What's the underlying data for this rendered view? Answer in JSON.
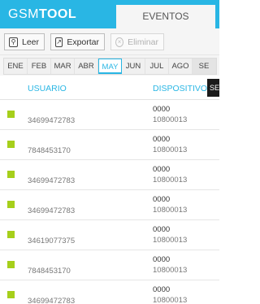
{
  "app": {
    "logo_part1": "GSM",
    "logo_part2": "TOOL",
    "tab_label": "EVENTOS"
  },
  "toolbar": {
    "read_label": "Leer",
    "export_label": "Exportar",
    "delete_label": "Eliminar"
  },
  "months": {
    "items": [
      "ENE",
      "FEB",
      "MAR",
      "ABR",
      "MAY",
      "JUN",
      "JUL",
      "AGO",
      "SE"
    ],
    "selected": "MAY"
  },
  "table": {
    "col_user": "USUARIO",
    "col_device": "DISPOSITIVO",
    "col_extra": "SE",
    "rows": [
      {
        "user": "34699472783",
        "device_line1": "0000",
        "device_line2": "10800013"
      },
      {
        "user": "7848453170",
        "device_line1": "0000",
        "device_line2": "10800013"
      },
      {
        "user": "34699472783",
        "device_line1": "0000",
        "device_line2": "10800013"
      },
      {
        "user": "34699472783",
        "device_line1": "0000",
        "device_line2": "10800013"
      },
      {
        "user": "34619077375",
        "device_line1": "0000",
        "device_line2": "10800013"
      },
      {
        "user": "7848453170",
        "device_line1": "0000",
        "device_line2": "10800013"
      },
      {
        "user": "34699472783",
        "device_line1": "0000",
        "device_line2": "10800013"
      }
    ]
  },
  "colors": {
    "accent": "#29b6e4",
    "status_square": "#a6cf1b"
  }
}
